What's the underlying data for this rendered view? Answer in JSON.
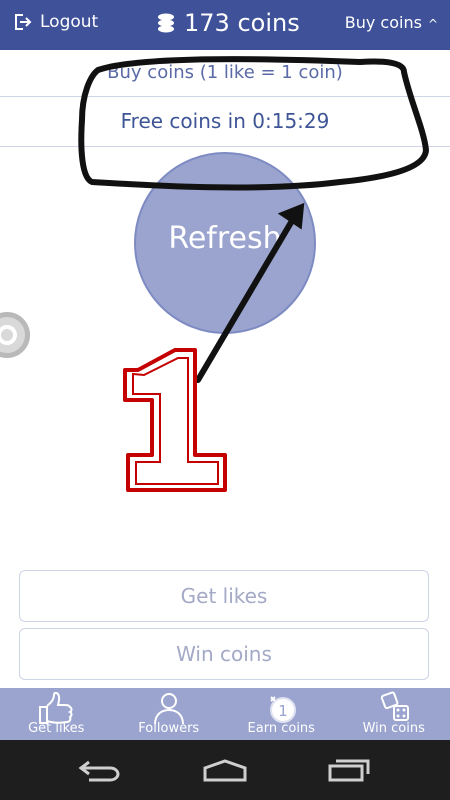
{
  "header": {
    "logout_label": "Logout",
    "coins_label": "173 coins",
    "buy_label": "Buy coins",
    "buy_chevron": "^"
  },
  "rows": {
    "buy_line": "Buy coins (1 like = 1 coin)",
    "free_coins": "Free coins in 0:15:29"
  },
  "refresh_label": "Refresh",
  "buttons": {
    "get_likes": "Get likes",
    "win_coins": "Win coins"
  },
  "bottom_nav": [
    {
      "label": "Get likes",
      "icon": "thumbs-up-icon"
    },
    {
      "label": "Followers",
      "icon": "user-icon"
    },
    {
      "label": "Earn coins",
      "icon": "coin-icon"
    },
    {
      "label": "Win coins",
      "icon": "dice-icon"
    }
  ],
  "annotation": {
    "number": "1",
    "colors": {
      "marker": "#111111",
      "number_outline": "#c40000"
    }
  },
  "colors": {
    "header_bg": "#3f5299",
    "nav_bg": "#9aa4cf",
    "refresh_bg": "#9aa4cf"
  }
}
